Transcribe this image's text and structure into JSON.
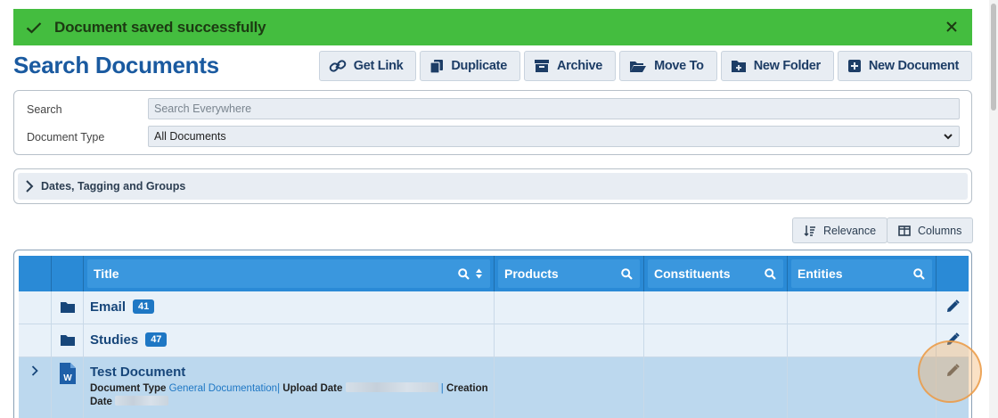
{
  "toast": {
    "message": "Document saved successfully"
  },
  "page": {
    "title": "Search Documents"
  },
  "toolbar": {
    "get_link": "Get Link",
    "duplicate": "Duplicate",
    "archive": "Archive",
    "move_to": "Move To",
    "new_folder": "New Folder",
    "new_document": "New Document"
  },
  "search": {
    "search_label": "Search",
    "search_placeholder": "Search Everywhere",
    "doctype_label": "Document Type",
    "doctype_value": "All Documents"
  },
  "filters": {
    "label": "Dates, Tagging and Groups"
  },
  "sort": {
    "relevance": "Relevance",
    "columns": "Columns"
  },
  "table": {
    "headers": {
      "title": "Title",
      "products": "Products",
      "constituents": "Constituents",
      "entities": "Entities"
    },
    "rows": [
      {
        "title": "Email",
        "badge": "41"
      },
      {
        "title": "Studies",
        "badge": "47"
      },
      {
        "title": "Test Document",
        "doctype_label": "Document Type",
        "doctype_value": "General Documentation",
        "separator": "|",
        "upload_label": "Upload Date",
        "creation_label": "Creation",
        "date_label": "Date"
      }
    ]
  },
  "colors": {
    "toast_bg": "#44bd3f",
    "title": "#1a5aa0",
    "header_bg": "#2a8ad6",
    "row_bg": "#e8f1f9",
    "selected_bg": "#bcd8ee"
  }
}
